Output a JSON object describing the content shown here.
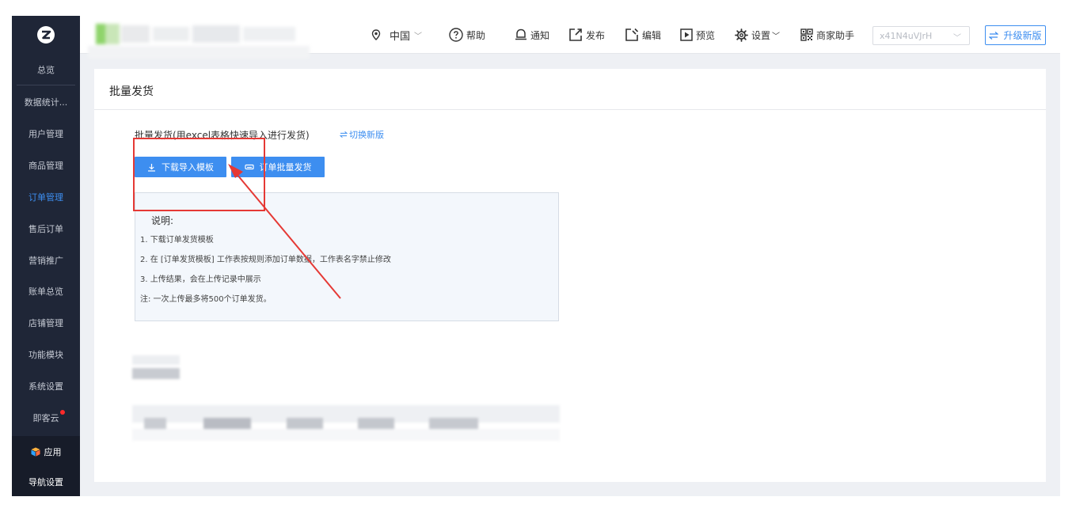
{
  "sidebar": {
    "items": [
      {
        "label": "总览"
      },
      {
        "label": "数据统计..."
      },
      {
        "label": "用户管理"
      },
      {
        "label": "商品管理"
      },
      {
        "label": "订单管理",
        "active": true
      },
      {
        "label": "售后订单"
      },
      {
        "label": "营销推广"
      },
      {
        "label": "账单总览"
      },
      {
        "label": "店铺管理"
      },
      {
        "label": "功能模块"
      },
      {
        "label": "系统设置"
      },
      {
        "label": "即客云",
        "has_badge": true
      }
    ],
    "bottom": [
      {
        "label": "应用",
        "icon": "cube-icon"
      },
      {
        "label": "导航设置"
      }
    ]
  },
  "header": {
    "region": "中国",
    "help": "帮助",
    "notify": "通知",
    "publish": "发布",
    "edit": "编辑",
    "preview": "预览",
    "settings": "设置",
    "assistant": "商家助手",
    "store_select": "x41N4uVJrH",
    "upgrade": "升级新版"
  },
  "content": {
    "title": "批量发货",
    "intro": "批量发货(用excel表格快速导入进行发货)",
    "switch_link": "切换新版",
    "download_btn": "下载导入模板",
    "batch_btn": "订单批量发货",
    "note": {
      "title": "说明:",
      "lines": [
        "1. 下载订单发货模板",
        "2. 在 [订单发货模板] 工作表按规则添加订单数据，工作表名字禁止修改",
        "3. 上传结果，会在上传记录中展示",
        "注: 一次上传最多将500个订单发货。"
      ]
    }
  },
  "colors": {
    "sidebar_bg": "#1f2637",
    "accent": "#3d8ef0",
    "annotation": "#e53935"
  }
}
